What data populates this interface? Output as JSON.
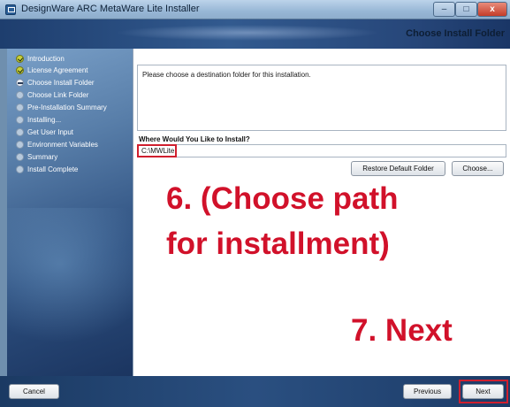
{
  "window": {
    "title": "DesignWare ARC MetaWare Lite Installer",
    "controls": {
      "minimize": "–",
      "maximize": "□",
      "close": "x"
    }
  },
  "header": {
    "step_title": "Choose Install Folder"
  },
  "steps": [
    {
      "label": "Introduction",
      "state": "done"
    },
    {
      "label": "License Agreement",
      "state": "done"
    },
    {
      "label": "Choose Install Folder",
      "state": "current"
    },
    {
      "label": "Choose Link Folder",
      "state": "pending"
    },
    {
      "label": "Pre-Installation Summary",
      "state": "pending"
    },
    {
      "label": "Installing...",
      "state": "pending"
    },
    {
      "label": "Get User Input",
      "state": "pending"
    },
    {
      "label": "Environment Variables",
      "state": "pending"
    },
    {
      "label": "Summary",
      "state": "pending"
    },
    {
      "label": "Install Complete",
      "state": "pending"
    }
  ],
  "content": {
    "description": "Please choose a destination folder for this installation.",
    "where_label": "Where Would You Like to Install?",
    "path_value": "C:\\MWLite",
    "restore_button": "Restore Default Folder",
    "choose_button": "Choose..."
  },
  "annotations": {
    "choose_path_line1": "6. (Choose path",
    "choose_path_line2": "for installment)",
    "next_step": "7. Next",
    "highlight_color": "#d01f2e"
  },
  "footer": {
    "cancel_button": "Cancel",
    "previous_button": "Previous",
    "next_button": "Next"
  }
}
